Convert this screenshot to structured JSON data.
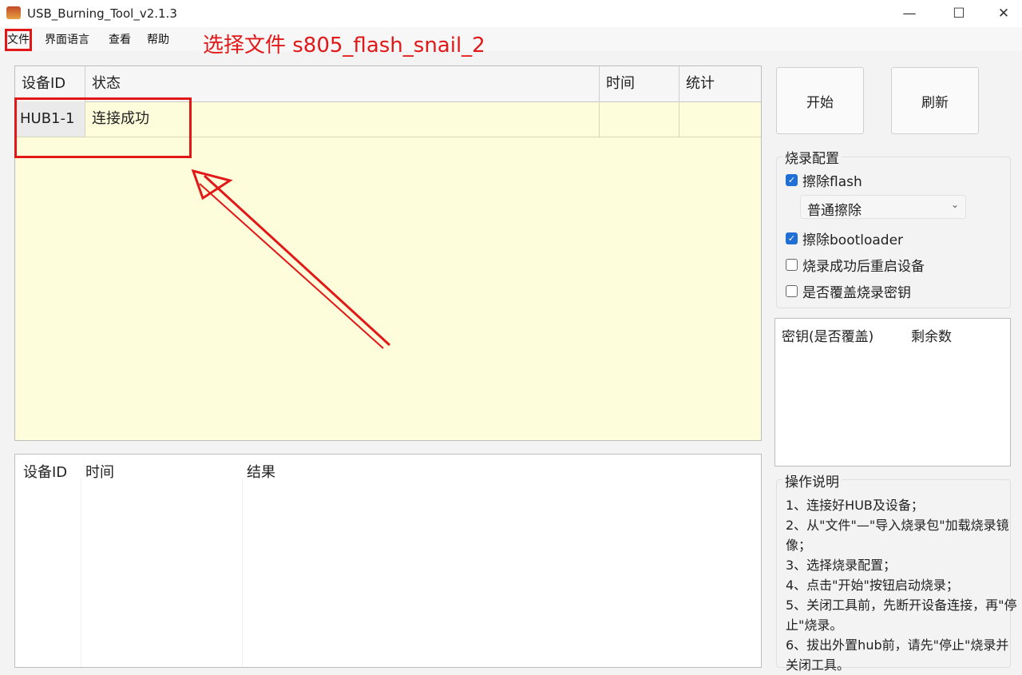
{
  "window": {
    "title": "USB_Burning_Tool_v2.1.3",
    "controls": {
      "minimize": "—",
      "maximize": "☐",
      "close": "✕"
    }
  },
  "menu": {
    "items": [
      "文件",
      "界面语言",
      "查看",
      "帮助"
    ]
  },
  "annotation": {
    "text": "选择文件 s805_flash_snail_2",
    "color": "#e21818"
  },
  "device_table": {
    "headers": [
      "设备ID",
      "状态",
      "时间",
      "统计"
    ],
    "rows": [
      {
        "id": "HUB1-1",
        "status": "连接成功",
        "time": "",
        "stats": ""
      }
    ]
  },
  "log_table": {
    "headers": [
      "设备ID",
      "时间",
      "结果"
    ]
  },
  "buttons": {
    "start": "开始",
    "refresh": "刷新"
  },
  "burn_config": {
    "title": "烧录配置",
    "erase_flash": {
      "label": "擦除flash",
      "checked": true
    },
    "erase_mode": "普通擦除",
    "erase_bootloader": {
      "label": "擦除bootloader",
      "checked": true
    },
    "reboot_after": {
      "label": "烧录成功后重启设备",
      "checked": false
    },
    "overwrite_key": {
      "label": "是否覆盖烧录密钥",
      "checked": false
    }
  },
  "key_table": {
    "headers": [
      "密钥(是否覆盖)",
      "剩余数"
    ]
  },
  "instructions": {
    "title": "操作说明",
    "lines": [
      "1、连接好HUB及设备；",
      "2、从\"文件\"—\"导入烧录包\"加载烧录镜像；",
      "3、选择烧录配置；",
      "4、点击\"开始\"按钮启动烧录；",
      "5、关闭工具前，先断开设备连接，再\"停止\"烧录。",
      "6、拔出外置hub前，请先\"停止\"烧录并关闭工具。"
    ]
  },
  "colors": {
    "device_bg": "#fdfcdb",
    "accent": "#1f6fd6",
    "annotation": "#e21818"
  }
}
